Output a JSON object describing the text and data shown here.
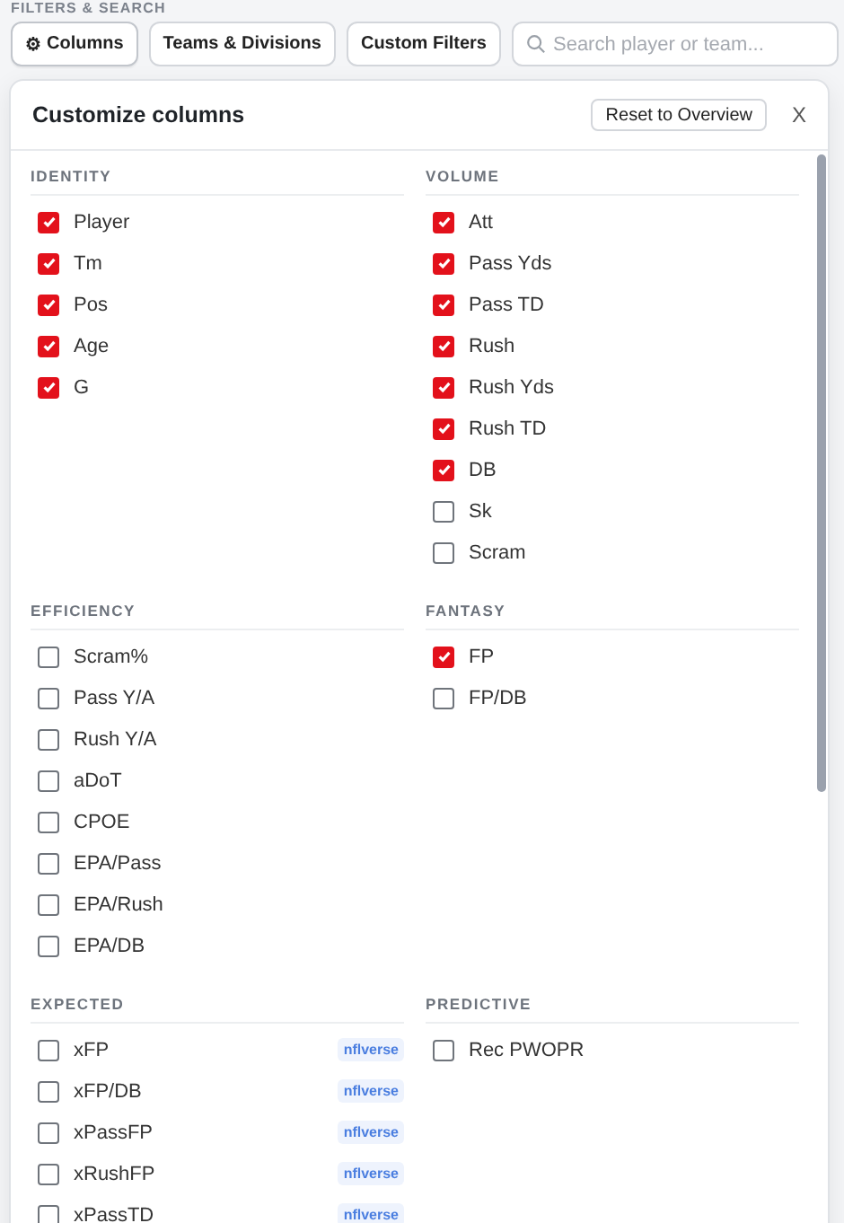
{
  "filters_label": "FILTERS & SEARCH",
  "toolbar": {
    "buttons": [
      {
        "label": "Columns",
        "icon": "⚙",
        "selected": true
      },
      {
        "label": "Teams & Divisions",
        "selected": false
      },
      {
        "label": "Custom Filters",
        "selected": false
      }
    ],
    "search": {
      "placeholder": "Search player or team..."
    }
  },
  "panel": {
    "title": "Customize columns",
    "reset_button": "Reset to Overview",
    "close": "X",
    "section_rows": [
      [
        {
          "title": "IDENTITY",
          "items": [
            {
              "label": "Player",
              "checked": true
            },
            {
              "label": "Tm",
              "checked": true
            },
            {
              "label": "Pos",
              "checked": true
            },
            {
              "label": "Age",
              "checked": true
            },
            {
              "label": "G",
              "checked": true
            }
          ]
        },
        {
          "title": "VOLUME",
          "items": [
            {
              "label": "Att",
              "checked": true
            },
            {
              "label": "Pass Yds",
              "checked": true
            },
            {
              "label": "Pass TD",
              "checked": true
            },
            {
              "label": "Rush",
              "checked": true
            },
            {
              "label": "Rush Yds",
              "checked": true
            },
            {
              "label": "Rush TD",
              "checked": true
            },
            {
              "label": "DB",
              "checked": true
            },
            {
              "label": "Sk",
              "checked": false
            },
            {
              "label": "Scram",
              "checked": false
            }
          ]
        }
      ],
      [
        {
          "title": "EFFICIENCY",
          "items": [
            {
              "label": "Scram%",
              "checked": false
            },
            {
              "label": "Pass Y/A",
              "checked": false
            },
            {
              "label": "Rush Y/A",
              "checked": false
            },
            {
              "label": "aDoT",
              "checked": false
            },
            {
              "label": "CPOE",
              "checked": false
            },
            {
              "label": "EPA/Pass",
              "checked": false
            },
            {
              "label": "EPA/Rush",
              "checked": false
            },
            {
              "label": "EPA/DB",
              "checked": false
            }
          ]
        },
        {
          "title": "FANTASY",
          "items": [
            {
              "label": "FP",
              "checked": true
            },
            {
              "label": "FP/DB",
              "checked": false
            }
          ]
        }
      ],
      [
        {
          "title": "EXPECTED",
          "items": [
            {
              "label": "xFP",
              "checked": false,
              "badge": "nflverse"
            },
            {
              "label": "xFP/DB",
              "checked": false,
              "badge": "nflverse"
            },
            {
              "label": "xPassFP",
              "checked": false,
              "badge": "nflverse"
            },
            {
              "label": "xRushFP",
              "checked": false,
              "badge": "nflverse"
            },
            {
              "label": "xPassTD",
              "checked": false,
              "badge": "nflverse"
            }
          ]
        },
        {
          "title": "PREDICTIVE",
          "items": [
            {
              "label": "Rec PWOPR",
              "checked": false
            }
          ]
        }
      ]
    ]
  }
}
